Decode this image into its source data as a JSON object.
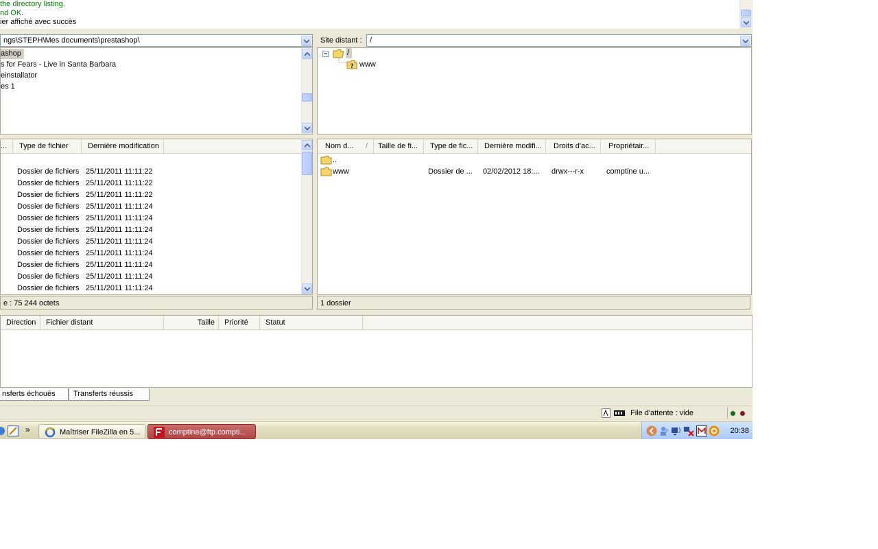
{
  "log": {
    "lines": [
      {
        "text": "the directory listing.",
        "color": "#008000"
      },
      {
        "text": "nd OK.",
        "color": "#008000"
      },
      {
        "text": "ier affiché avec succès",
        "color": "#000000"
      }
    ]
  },
  "local": {
    "path": "ngs\\STEPH\\Mes documents\\prestashop\\",
    "tree": [
      "ashop",
      "s for Fears - Live in Santa Barbara",
      "einstallator",
      "es 1"
    ],
    "columns": [
      "...",
      "Type de fichier",
      "Dernière modification"
    ],
    "rows": [
      {
        "type": "Dossier de fichiers",
        "modified": "25/11/2011 11:11:22"
      },
      {
        "type": "Dossier de fichiers",
        "modified": "25/11/2011 11:11:22"
      },
      {
        "type": "Dossier de fichiers",
        "modified": "25/11/2011 11:11:22"
      },
      {
        "type": "Dossier de fichiers",
        "modified": "25/11/2011 11:11:24"
      },
      {
        "type": "Dossier de fichiers",
        "modified": "25/11/2011 11:11:24"
      },
      {
        "type": "Dossier de fichiers",
        "modified": "25/11/2011 11:11:24"
      },
      {
        "type": "Dossier de fichiers",
        "modified": "25/11/2011 11:11:24"
      },
      {
        "type": "Dossier de fichiers",
        "modified": "25/11/2011 11:11:24"
      },
      {
        "type": "Dossier de fichiers",
        "modified": "25/11/2011 11:11:24"
      },
      {
        "type": "Dossier de fichiers",
        "modified": "25/11/2011 11:11:24"
      },
      {
        "type": "Dossier de fichiers",
        "modified": "25/11/2011 11:11:24"
      }
    ],
    "status": "e : 75 244 octets"
  },
  "remote": {
    "label": "Site distant :",
    "path": "/",
    "tree_root": "/",
    "tree_child": "www",
    "columns": [
      "Nom d...",
      "/",
      "Taille de fi...",
      "Type de fic...",
      "Dernière modifi...",
      "Droits d'ac...",
      "Propriétair..."
    ],
    "parent_entry": "..",
    "rows": [
      {
        "name": "www",
        "size": "",
        "type": "Dossier de ...",
        "modified": "02/02/2012 18:...",
        "perms": "drwx---r-x",
        "owner": "comptine u..."
      }
    ],
    "status": "1 dossier"
  },
  "queue": {
    "columns": [
      "Direction",
      "Fichier distant",
      "Taille",
      "Priorité",
      "Statut"
    ],
    "tabs": [
      "nsferts échoués",
      "Transferts réussis"
    ]
  },
  "statusbar": {
    "queue_text": "File d'attente : vide"
  },
  "taskbar": {
    "buttons": [
      {
        "label": "Maîtriser FileZilla en 5...",
        "active": false
      },
      {
        "label": "comptine@ftp.compti...",
        "active": true
      }
    ],
    "overflow": "»",
    "clock": "20:38"
  },
  "colors": {
    "log_success": "#008000",
    "selection": "#d4d0c8",
    "taskbar_active": "#b14646",
    "tray": "#a9c9f7"
  }
}
